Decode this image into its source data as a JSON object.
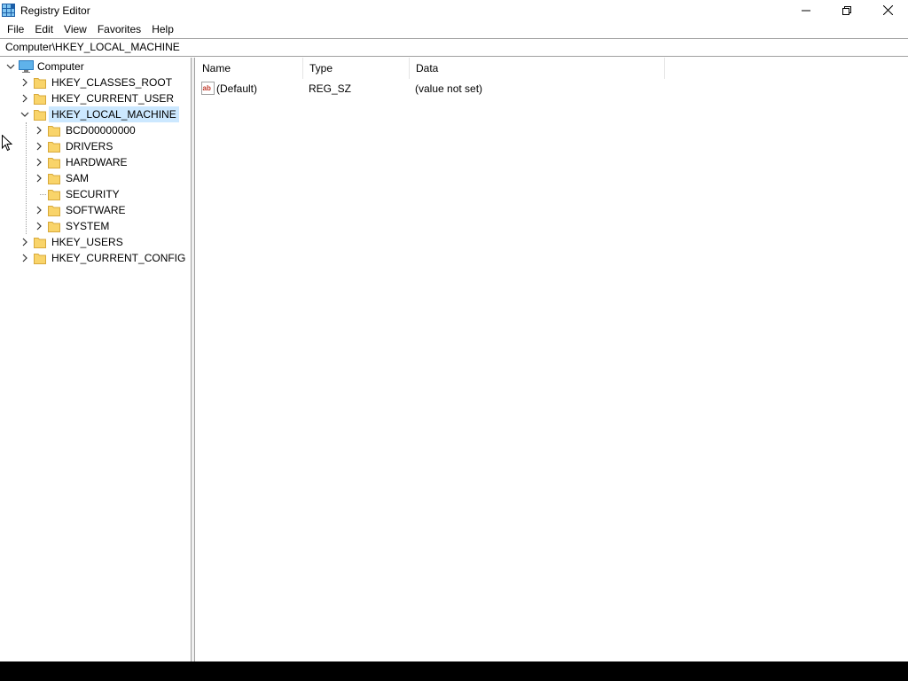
{
  "window": {
    "title": "Registry Editor"
  },
  "menu": [
    "File",
    "Edit",
    "View",
    "Favorites",
    "Help"
  ],
  "address": "Computer\\HKEY_LOCAL_MACHINE",
  "tree": {
    "root": "Computer",
    "hives": [
      {
        "label": "HKEY_CLASSES_ROOT"
      },
      {
        "label": "HKEY_CURRENT_USER"
      },
      {
        "label": "HKEY_LOCAL_MACHINE",
        "selected": true
      },
      {
        "label": "HKEY_USERS"
      },
      {
        "label": "HKEY_CURRENT_CONFIG"
      }
    ],
    "hklm_children": [
      "BCD00000000",
      "DRIVERS",
      "HARDWARE",
      "SAM",
      "SECURITY",
      "SOFTWARE",
      "SYSTEM"
    ]
  },
  "list": {
    "columns": [
      "Name",
      "Type",
      "Data"
    ],
    "rows": [
      {
        "name": "(Default)",
        "type": "REG_SZ",
        "data": "(value not set)"
      }
    ]
  },
  "colors": {
    "selection": "#cce8ff",
    "folder": "#f9d46a",
    "border": "#a0a0a0"
  }
}
